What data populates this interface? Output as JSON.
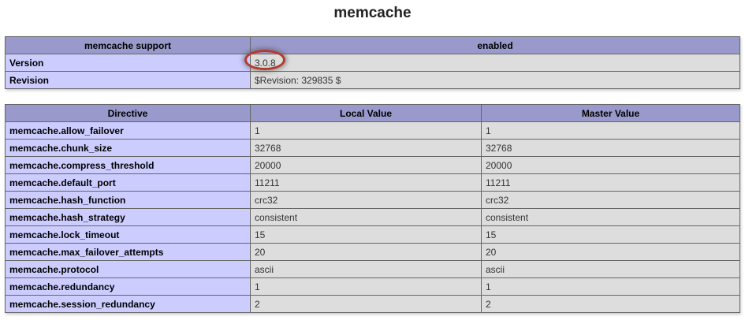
{
  "title": "memcache",
  "support_table": {
    "header": [
      "memcache support",
      "enabled"
    ],
    "rows": [
      {
        "label": "Version",
        "value": "3.0.8"
      },
      {
        "label": "Revision",
        "value": "$Revision: 329835 $"
      }
    ]
  },
  "directive_table": {
    "headers": [
      "Directive",
      "Local Value",
      "Master Value"
    ],
    "rows": [
      {
        "directive": "memcache.allow_failover",
        "local": "1",
        "master": "1"
      },
      {
        "directive": "memcache.chunk_size",
        "local": "32768",
        "master": "32768"
      },
      {
        "directive": "memcache.compress_threshold",
        "local": "20000",
        "master": "20000"
      },
      {
        "directive": "memcache.default_port",
        "local": "11211",
        "master": "11211"
      },
      {
        "directive": "memcache.hash_function",
        "local": "crc32",
        "master": "crc32"
      },
      {
        "directive": "memcache.hash_strategy",
        "local": "consistent",
        "master": "consistent"
      },
      {
        "directive": "memcache.lock_timeout",
        "local": "15",
        "master": "15"
      },
      {
        "directive": "memcache.max_failover_attempts",
        "local": "20",
        "master": "20"
      },
      {
        "directive": "memcache.protocol",
        "local": "ascii",
        "master": "ascii"
      },
      {
        "directive": "memcache.redundancy",
        "local": "1",
        "master": "1"
      },
      {
        "directive": "memcache.session_redundancy",
        "local": "2",
        "master": "2"
      }
    ]
  },
  "colors": {
    "header_bg": "#9999cc",
    "label_bg": "#ccccff",
    "value_bg": "#dddddd",
    "annotation_circle": "#b53a2e"
  }
}
